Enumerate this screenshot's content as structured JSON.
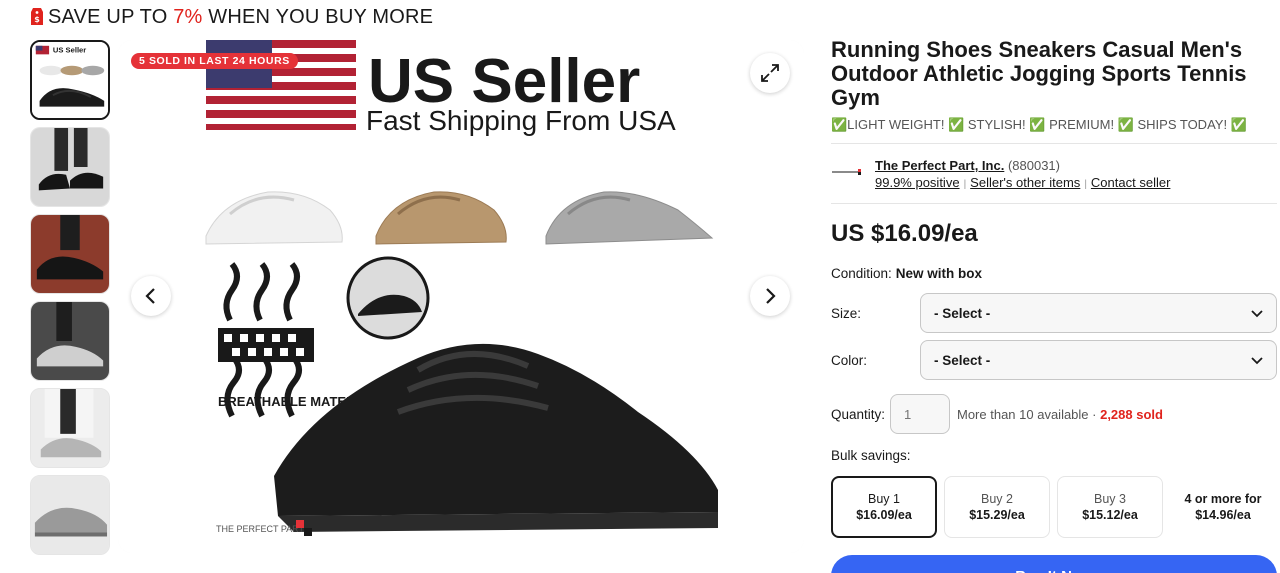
{
  "promo": {
    "prefix": "SAVE UP TO ",
    "percent": "7%",
    "suffix": " WHEN YOU BUY MORE"
  },
  "hero": {
    "badge": "5 SOLD IN LAST 24 HOURS",
    "headline": "US Seller",
    "subline": "Fast Shipping From USA",
    "feature_label": "BREATHABLE MATERIAL",
    "brand_mark": "THE PERFECT PART"
  },
  "thumbnails": [
    {
      "label": "US Seller"
    },
    {
      "label": ""
    },
    {
      "label": ""
    },
    {
      "label": ""
    },
    {
      "label": ""
    },
    {
      "label": ""
    }
  ],
  "listing": {
    "title": "Running Shoes Sneakers Casual Men's Outdoor Athletic Jogging Sports Tennis Gym",
    "subtitle": "✅LIGHT WEIGHT! ✅ STYLISH! ✅ PREMIUM! ✅ SHIPS TODAY! ✅",
    "price": "US $16.09/ea",
    "condition_label": "Condition:",
    "condition_value": "New with box"
  },
  "seller": {
    "name": "The Perfect Part, Inc.",
    "feedback_count": "(880031)",
    "positive": "99.9% positive",
    "other_items": "Seller's other items",
    "contact": "Contact seller"
  },
  "options": {
    "size_label": "Size:",
    "size_value": "- Select -",
    "color_label": "Color:",
    "color_value": "- Select -"
  },
  "quantity": {
    "label": "Quantity:",
    "placeholder": "1",
    "available": "More than 10 available · ",
    "sold": "2,288 sold"
  },
  "bulk": {
    "label": "Bulk savings:",
    "tiers": [
      {
        "qty": "Buy 1",
        "price": "$16.09/ea"
      },
      {
        "qty": "Buy 2",
        "price": "$15.29/ea"
      },
      {
        "qty": "Buy 3",
        "price": "$15.12/ea"
      }
    ],
    "more": {
      "qty": "4 or more for",
      "price": "$14.96/ea"
    }
  },
  "buy_now": "Buy It Now",
  "colors": {
    "accent": "#3665f3",
    "sale_red": "#e0231d",
    "badge_red": "#e53238"
  }
}
